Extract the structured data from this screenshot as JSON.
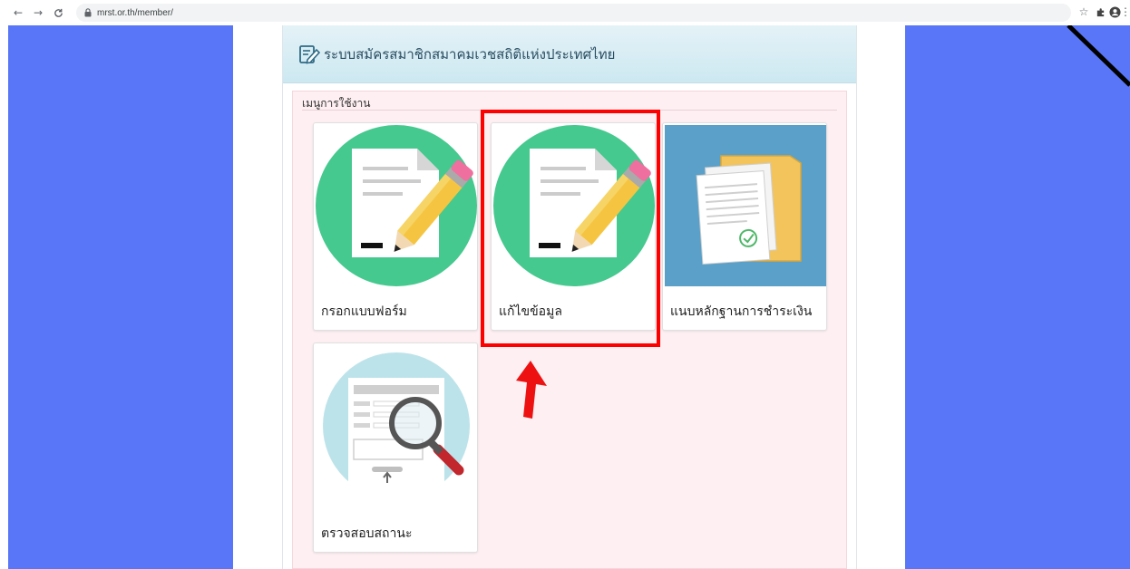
{
  "browser": {
    "url": "mrst.or.th/member/"
  },
  "header": {
    "title": "ระบบสมัครสมาชิกสมาคมเวชสถิติแห่งประเทศไทย"
  },
  "menu": {
    "heading": "เมนูการใช้งาน",
    "cards": [
      {
        "label": "กรอกแบบฟอร์ม",
        "icon": "form-pencil-icon"
      },
      {
        "label": "แก้ไขข้อมูล",
        "icon": "form-pencil-icon"
      },
      {
        "label": "แนบหลักฐานการชำระเงิน",
        "icon": "documents-envelope-icon"
      },
      {
        "label": "ตรวจสอบสถานะ",
        "icon": "document-magnifier-icon"
      }
    ]
  },
  "colors": {
    "side_bg": "#5876f7",
    "menu_bg": "#fdeff2",
    "highlight": "#ff0000",
    "green_circle": "#45c98f",
    "upload_bg": "#5aa0c8"
  }
}
